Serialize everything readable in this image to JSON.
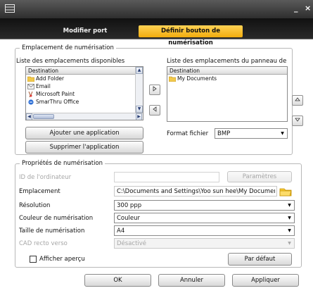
{
  "window": {
    "minimize": "_",
    "close": "×"
  },
  "tabs": [
    {
      "label": "Modifier port",
      "active": false
    },
    {
      "label": "Définir bouton de numérisation",
      "active": true
    }
  ],
  "scan_locations": {
    "group_title": "Emplacement de numérisation",
    "available_label": "Liste des emplacements disponibles",
    "panel_label": "Liste des emplacements du panneau de",
    "available_header": "Destination",
    "available_items": [
      {
        "label": "Add Folder",
        "icon": "folder-add-icon"
      },
      {
        "label": "Email",
        "icon": "email-icon"
      },
      {
        "label": "Microsoft Paint",
        "icon": "paint-icon"
      },
      {
        "label": "SmarThru Office",
        "icon": "smarthru-icon"
      }
    ],
    "panel_header": "Destination",
    "panel_items": [
      {
        "label": "My Documents",
        "icon": "folder-icon"
      }
    ],
    "add_app_button": "Ajouter une application",
    "remove_app_button": "Supprimer l'application",
    "file_format_label": "Format fichier",
    "file_format_value": "BMP"
  },
  "scan_properties": {
    "group_title": "Propriétés de numérisation",
    "computer_id_label": "ID de l'ordinateur",
    "computer_id_value": "",
    "params_button": "Paramètres",
    "location_label": "Emplacement",
    "location_value": "C:\\Documents and Settings\\Yoo sun hee\\My Document",
    "resolution_label": "Résolution",
    "resolution_value": "300 ppp",
    "color_label": "Couleur de numérisation",
    "color_value": "Couleur",
    "size_label": "Taille de numérisation",
    "size_value": "A4",
    "duplex_label": "CAD recto verso",
    "duplex_value": "Désactivé",
    "preview_label": "Afficher aperçu",
    "preview_checked": false,
    "default_button": "Par défaut"
  },
  "footer": {
    "ok": "OK",
    "cancel": "Annuler",
    "apply": "Appliquer"
  },
  "colors": {
    "active_tab": "#f5b31c",
    "title_bar": "#3a3a3a"
  }
}
